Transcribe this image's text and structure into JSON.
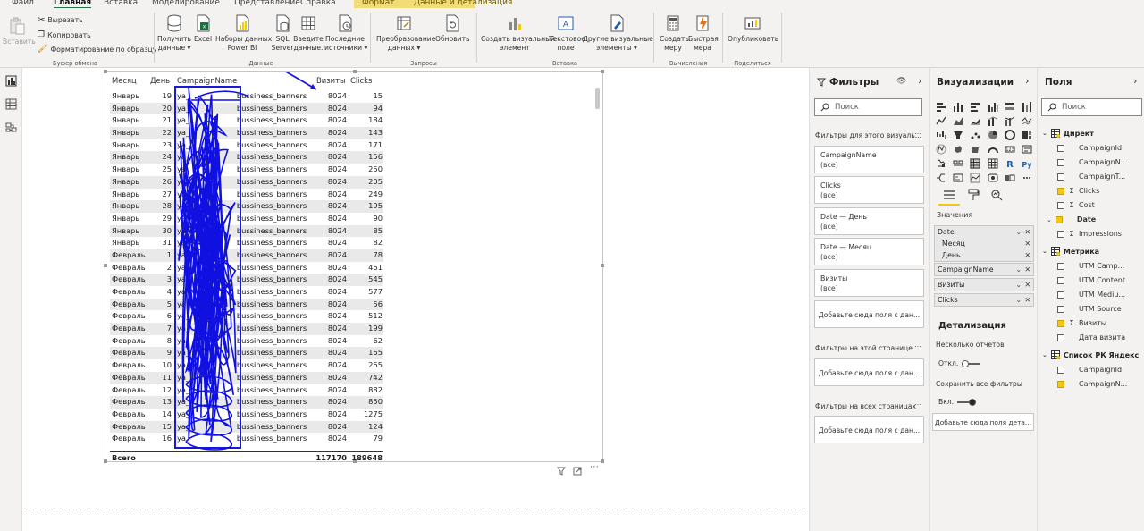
{
  "tabs": [
    "Файл",
    "Главная",
    "Вставка",
    "Моделирование",
    "Представление",
    "Справка",
    "Формат",
    "Данные и детализация"
  ],
  "ribbon": {
    "paste": "Вставить",
    "cut": "Вырезать",
    "copy": "Копировать",
    "format_painter": "Форматирование по образцу",
    "clipboard_group": "Буфер обмена",
    "get_data": [
      "Получить",
      "данные ▾"
    ],
    "excel": "Excel",
    "datasets": [
      "Наборы данных",
      "Power BI"
    ],
    "sql": [
      "SQL",
      "Server"
    ],
    "enter_data": [
      "Введите",
      "данные."
    ],
    "recent_sources": [
      "Последние",
      "источники ▾"
    ],
    "data_group": "Данные",
    "transform": [
      "Преобразование",
      "данных ▾"
    ],
    "refresh": "Обновить",
    "queries_group": "Запросы",
    "new_visual": [
      "Создать визуальный",
      "элемент"
    ],
    "text_box": [
      "Текстовое",
      "поле"
    ],
    "more_visuals": [
      "Другие визуальные",
      "элементы ▾"
    ],
    "insert_group": "Вставка",
    "new_measure": [
      "Создать",
      "меру"
    ],
    "quick_measure": [
      "Быстрая",
      "мера"
    ],
    "calc_group": "Вычисления",
    "publish": "Опубликовать",
    "share_group": "Поделиться"
  },
  "table": {
    "headers": [
      "Месяц",
      "День",
      "CampaignName",
      "Визиты",
      "Clicks"
    ],
    "rows": [
      [
        "Январь",
        "19",
        "ya_",
        "bussiness_banners",
        "8024",
        "15"
      ],
      [
        "Январь",
        "20",
        "ya_",
        "bussiness_banners",
        "8024",
        "94"
      ],
      [
        "Январь",
        "21",
        "ya_",
        "bussiness_banners",
        "8024",
        "184"
      ],
      [
        "Январь",
        "22",
        "ya_",
        "bussiness_banners",
        "8024",
        "143"
      ],
      [
        "Январь",
        "23",
        "ya_",
        "bussiness_banners",
        "8024",
        "171"
      ],
      [
        "Январь",
        "24",
        "ya_",
        "bussiness_banners",
        "8024",
        "156"
      ],
      [
        "Январь",
        "25",
        "ya_",
        "bussiness_banners",
        "8024",
        "250"
      ],
      [
        "Январь",
        "26",
        "ya_",
        "bussiness_banners",
        "8024",
        "205"
      ],
      [
        "Январь",
        "27",
        "ya_",
        "bussiness_banners",
        "8024",
        "249"
      ],
      [
        "Январь",
        "28",
        "ya_",
        "bussiness_banners",
        "8024",
        "195"
      ],
      [
        "Январь",
        "29",
        "ya_",
        "bussiness_banners",
        "8024",
        "90"
      ],
      [
        "Январь",
        "30",
        "ya_",
        "bussiness_banners",
        "8024",
        "85"
      ],
      [
        "Январь",
        "31",
        "ya_",
        "bussiness_banners",
        "8024",
        "82"
      ],
      [
        "Февраль",
        "1",
        "ya_",
        "bussiness_banners",
        "8024",
        "78"
      ],
      [
        "Февраль",
        "2",
        "ya_",
        "bussiness_banners",
        "8024",
        "461"
      ],
      [
        "Февраль",
        "3",
        "ya_",
        "bussiness_banners",
        "8024",
        "545"
      ],
      [
        "Февраль",
        "4",
        "ya_",
        "bussiness_banners",
        "8024",
        "577"
      ],
      [
        "Февраль",
        "5",
        "ya_",
        "bussiness_banners",
        "8024",
        "56"
      ],
      [
        "Февраль",
        "6",
        "ya_",
        "bussiness_banners",
        "8024",
        "512"
      ],
      [
        "Февраль",
        "7",
        "ya_",
        "bussiness_banners",
        "8024",
        "199"
      ],
      [
        "Февраль",
        "8",
        "ya_",
        "bussiness_banners",
        "8024",
        "62"
      ],
      [
        "Февраль",
        "9",
        "ya_",
        "bussiness_banners",
        "8024",
        "165"
      ],
      [
        "Февраль",
        "10",
        "ya_",
        "bussiness_banners",
        "8024",
        "265"
      ],
      [
        "Февраль",
        "11",
        "ya_",
        "bussiness_banners",
        "8024",
        "742"
      ],
      [
        "Февраль",
        "12",
        "ya_",
        "bussiness_banners",
        "8024",
        "882"
      ],
      [
        "Февраль",
        "13",
        "ya_",
        "bussiness_banners",
        "8024",
        "850"
      ],
      [
        "Февраль",
        "14",
        "ya_",
        "bussiness_banners",
        "8024",
        "1275"
      ],
      [
        "Февраль",
        "15",
        "ya_",
        "bussiness_banners",
        "8024",
        "124"
      ],
      [
        "Февраль",
        "16",
        "ya_",
        "bussiness_banners",
        "8024",
        "79"
      ]
    ],
    "total_label": "Всего",
    "total_visits": "117170",
    "total_clicks": "189648"
  },
  "filters": {
    "title": "Фильтры",
    "search_placeholder": "Поиск",
    "section_visual": "Фильтры для этого визуаль...",
    "cards": [
      {
        "name": "CampaignName",
        "value": "(все)"
      },
      {
        "name": "Clicks",
        "value": "(все)"
      },
      {
        "name": "Date — День",
        "value": "(все)"
      },
      {
        "name": "Date — Месяц",
        "value": "(все)"
      },
      {
        "name": "Визиты",
        "value": "(все)"
      }
    ],
    "add_here": "Добавьте сюда поля с дан...",
    "section_page": "Фильтры на этой странице",
    "section_all": "Фильтры на всех страницах"
  },
  "viz": {
    "title": "Визуализации",
    "values_label": "Значения",
    "wells": [
      "Date",
      "Месяц",
      "День",
      "CampaignName",
      "Визиты",
      "Clicks"
    ],
    "drill_title": "Детализация",
    "cross_report": "Несколько отчетов",
    "off_label": "Откл.",
    "keep_filters": "Сохранить все фильтры",
    "on_label": "Вкл.",
    "add_drill": "Добавьте сюда поля дета..."
  },
  "fields": {
    "title": "Поля",
    "search_placeholder": "Поиск",
    "tables": [
      {
        "name": "Директ",
        "items": [
          {
            "label": "CampaignId",
            "checked": false,
            "sigma": false
          },
          {
            "label": "CampaignN...",
            "checked": false,
            "sigma": false
          },
          {
            "label": "CampaignT...",
            "checked": false,
            "sigma": false
          },
          {
            "label": "Clicks",
            "checked": true,
            "sigma": true
          },
          {
            "label": "Cost",
            "checked": false,
            "sigma": true
          },
          {
            "label": "Date",
            "checked": true,
            "sigma": false
          },
          {
            "label": "Impressions",
            "checked": false,
            "sigma": true
          }
        ]
      },
      {
        "name": "Метрика",
        "items": [
          {
            "label": "UTM Camp...",
            "checked": false,
            "sigma": false
          },
          {
            "label": "UTM Content",
            "checked": false,
            "sigma": false
          },
          {
            "label": "UTM Mediu...",
            "checked": false,
            "sigma": false
          },
          {
            "label": "UTM Source",
            "checked": false,
            "sigma": false
          },
          {
            "label": "Визиты",
            "checked": true,
            "sigma": true
          },
          {
            "label": "Дата визита",
            "checked": false,
            "sigma": false
          }
        ]
      },
      {
        "name": "Список РК Яндекс",
        "items": [
          {
            "label": "CampaignId",
            "checked": false,
            "sigma": false
          },
          {
            "label": "CampaignN...",
            "checked": true,
            "sigma": false
          }
        ]
      }
    ]
  },
  "colors": {
    "accent": "#f2c811",
    "scribble": "#1010e0",
    "ribbon_bg": "#f3f2f1"
  }
}
